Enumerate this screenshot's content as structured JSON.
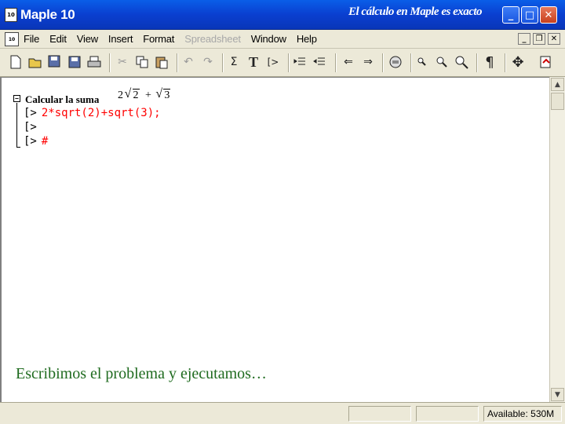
{
  "window": {
    "app_icon_text": "10",
    "app_title": "Maple 10",
    "slide_title": "El cálculo en Maple es exacto",
    "controls": {
      "minimize": "_",
      "maximize": "□",
      "close": "✕"
    }
  },
  "menubar": {
    "doc_icon_text": "10",
    "items": [
      {
        "label": "File",
        "enabled": true
      },
      {
        "label": "Edit",
        "enabled": true
      },
      {
        "label": "View",
        "enabled": true
      },
      {
        "label": "Insert",
        "enabled": true
      },
      {
        "label": "Format",
        "enabled": true
      },
      {
        "label": "Spreadsheet",
        "enabled": false
      },
      {
        "label": "Window",
        "enabled": true
      },
      {
        "label": "Help",
        "enabled": true
      }
    ],
    "mdi": {
      "minimize": "_",
      "restore": "❐",
      "close": "✕"
    }
  },
  "toolbar": {
    "buttons": [
      "new-icon",
      "open-icon",
      "save-as-icon",
      "save-icon",
      "print-icon",
      "cut-icon",
      "copy-icon",
      "paste-icon",
      "undo-icon",
      "redo-icon",
      "sigma-icon",
      "text-icon",
      "prompt-icon",
      "indent-icon",
      "outdent-icon",
      "back-icon",
      "forward-icon",
      "stop-icon",
      "zoom-small-icon",
      "zoom-medium-icon",
      "zoom-large-icon",
      "pilcrow-icon",
      "move-icon",
      "restart-icon"
    ],
    "glyphs": {
      "sigma": "Σ",
      "text": "T",
      "prompt": "[>",
      "pilcrow": "¶",
      "back": "⇐",
      "forward": "⇒",
      "undo": "↶",
      "redo": "↷",
      "cut": "✂",
      "move": "✥"
    }
  },
  "document": {
    "section_title": "Calcular la suma",
    "math": {
      "coef": "2",
      "radicand_1": "2",
      "op": "+",
      "radicand_2": "3"
    },
    "collapse_symbol": "−",
    "prompts": [
      {
        "prompt": "[>",
        "command": "2*sqrt(2)+sqrt(3);"
      },
      {
        "prompt": "[>",
        "command": ""
      },
      {
        "prompt": "[>",
        "command": "#"
      }
    ],
    "caption": "Escribimos el problema y ejecutamos…"
  },
  "statusbar": {
    "available": "Available: 530M"
  },
  "colors": {
    "titlebar": "#0a5ee8",
    "command_text": "#ff0000",
    "caption_text": "#1f6b1f",
    "chrome": "#ece9d8"
  }
}
